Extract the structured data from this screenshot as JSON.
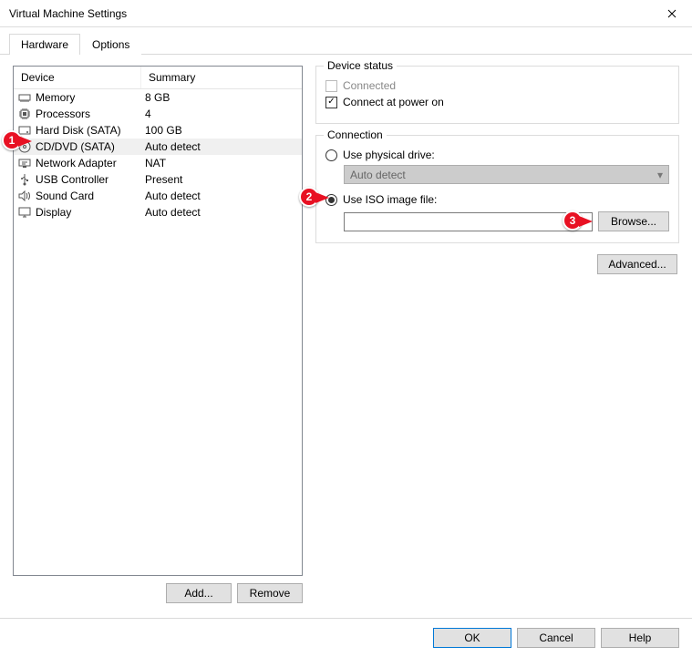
{
  "window": {
    "title": "Virtual Machine Settings"
  },
  "tabs": [
    {
      "label": "Hardware",
      "active": true
    },
    {
      "label": "Options",
      "active": false
    }
  ],
  "deviceList": {
    "headers": {
      "device": "Device",
      "summary": "Summary"
    },
    "rows": [
      {
        "icon": "memory-icon",
        "name": "Memory",
        "summary": "8 GB"
      },
      {
        "icon": "processor-icon",
        "name": "Processors",
        "summary": "4"
      },
      {
        "icon": "harddisk-icon",
        "name": "Hard Disk (SATA)",
        "summary": "100 GB"
      },
      {
        "icon": "disc-icon",
        "name": "CD/DVD (SATA)",
        "summary": "Auto detect",
        "selected": true
      },
      {
        "icon": "network-icon",
        "name": "Network Adapter",
        "summary": "NAT"
      },
      {
        "icon": "usb-icon",
        "name": "USB Controller",
        "summary": "Present"
      },
      {
        "icon": "sound-icon",
        "name": "Sound Card",
        "summary": "Auto detect"
      },
      {
        "icon": "display-icon",
        "name": "Display",
        "summary": "Auto detect"
      }
    ]
  },
  "leftButtons": {
    "add": "Add...",
    "remove": "Remove"
  },
  "deviceStatus": {
    "legend": "Device status",
    "connected": {
      "label": "Connected",
      "checked": false,
      "enabled": false
    },
    "connectPowerOn": {
      "label": "Connect at power on",
      "checked": true,
      "enabled": true
    }
  },
  "connection": {
    "legend": "Connection",
    "physical": {
      "label": "Use physical drive:",
      "selected": false,
      "dropdown": "Auto detect"
    },
    "iso": {
      "label": "Use ISO image file:",
      "selected": true,
      "path": "",
      "browse": "Browse..."
    }
  },
  "advanced": {
    "label": "Advanced..."
  },
  "footer": {
    "ok": "OK",
    "cancel": "Cancel",
    "help": "Help"
  },
  "callouts": [
    {
      "num": "1"
    },
    {
      "num": "2"
    },
    {
      "num": "3"
    }
  ]
}
